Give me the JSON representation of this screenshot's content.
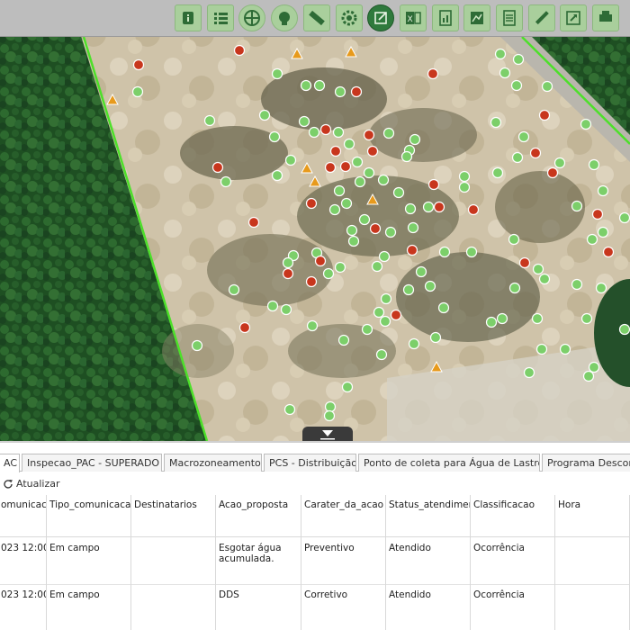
{
  "toolbar": {
    "buttons": [
      {
        "name": "identify-button",
        "icon": "info-icon"
      },
      {
        "name": "list-button",
        "icon": "list-icon"
      },
      {
        "name": "layers-button",
        "icon": "grid-icon"
      },
      {
        "name": "search-button",
        "icon": "search-icon"
      },
      {
        "name": "measure-button",
        "icon": "ruler-icon"
      },
      {
        "name": "settings-button",
        "icon": "gear-icon"
      },
      {
        "name": "edit-button",
        "icon": "edit-icon"
      },
      {
        "name": "excel-button",
        "icon": "excel-icon"
      },
      {
        "name": "report-button",
        "icon": "report-icon"
      },
      {
        "name": "map-button",
        "icon": "map-icon"
      },
      {
        "name": "document-button",
        "icon": "document-icon"
      },
      {
        "name": "draw-button",
        "icon": "pencil-icon"
      },
      {
        "name": "export-button",
        "icon": "export-icon"
      },
      {
        "name": "print-button",
        "icon": "print-icon"
      }
    ],
    "active_button": "edit-button"
  },
  "map": {
    "marker_colors": {
      "green": "#7ccf6a",
      "red": "#c8361d",
      "orange": "#e79a1c"
    },
    "boundary_color": "#4de02a"
  },
  "tabs": [
    {
      "label": "AC",
      "active": true
    },
    {
      "label": "Inspecao_PAC - SUPERADO",
      "active": false
    },
    {
      "label": "Macrozoneamento",
      "active": false
    },
    {
      "label": "PCS - Distribuição",
      "active": false
    },
    {
      "label": "Ponto de coleta para Água de Lastro",
      "active": false
    },
    {
      "label": "Programa Descon",
      "active": false
    }
  ],
  "refresh_label": "Atualizar",
  "table": {
    "columns": [
      "omunicaca",
      "Tipo_comunicaca",
      "Destinatarios",
      "Acao_proposta",
      "Carater_da_acao",
      "Status_atendimer",
      "Classificacao",
      "Hora"
    ],
    "rows": [
      [
        "023 12:00",
        "Em campo",
        "",
        "Esgotar água acumulada.",
        "Preventivo",
        "Atendido",
        "Ocorrência",
        ""
      ],
      [
        "023 12:00",
        "Em campo",
        "",
        "DDS",
        "Corretivo",
        "Atendido",
        "Ocorrência",
        ""
      ]
    ]
  }
}
